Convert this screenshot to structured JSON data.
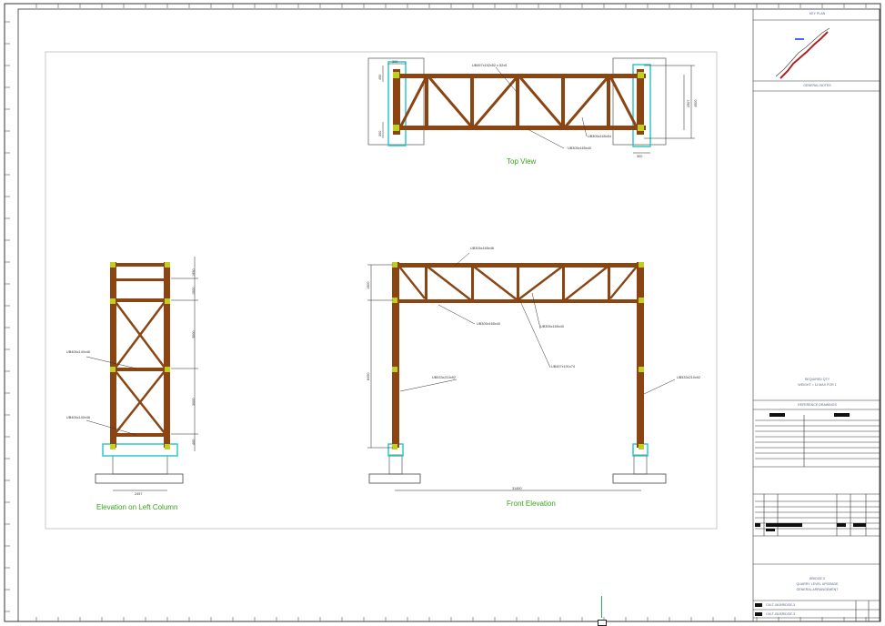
{
  "drawing": {
    "colors": {
      "steel": "#8b4513",
      "steel_light": "#c08040",
      "base": "#22c5c5",
      "dim": "#222222",
      "title": "#3aa020",
      "frame": "#333333"
    }
  },
  "views": {
    "top": {
      "title": "Top View",
      "callouts": [
        "UB457x152x52 x 52x5",
        "UB305x165x54",
        "UB305x165x40"
      ],
      "dims": [
        "300",
        "450",
        "300",
        "4500",
        "2507",
        "300"
      ]
    },
    "side": {
      "title": "Elevation on Left Column",
      "callouts": [
        "UB406x140x46",
        "UB406x140x46"
      ],
      "dims": [
        "1950",
        "1500",
        "3000",
        "3000",
        "450",
        "2497"
      ]
    },
    "front": {
      "title": "Front Elevation",
      "callouts": [
        "UB305x165x46",
        "UB305x165x40",
        "UB305x165x40",
        "UB457x191x74",
        "UB533x210x92",
        "UB533x210x92"
      ],
      "dims": [
        "1500",
        "8450",
        "31450"
      ]
    }
  },
  "title_block": {
    "key_plan": "KEY PLAN",
    "general_notes": "GENERAL NOTES",
    "required_qty": "REQUIRED QTY",
    "weight_note": "WEIGHT ≈ 11 MAX FOR 1",
    "reference_drawings": "REFERENCE DRAWINGS",
    "project_line1": "BRIDGE 3",
    "project_line2": "QUARRY LEVEL UPGRADE",
    "project_line3": "GENERAL ARRANGEMENT",
    "drawing_no_1": "CM-T-08-BRIDGE-3",
    "drawing_no_2": "CM-T-08-BRIDGE-3"
  }
}
